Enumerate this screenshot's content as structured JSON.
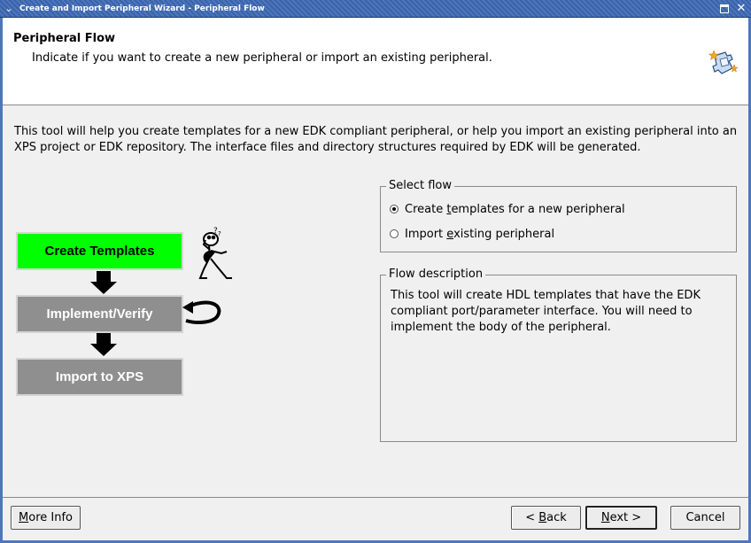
{
  "window": {
    "title": "Create and Import Peripheral Wizard - Peripheral Flow"
  },
  "header": {
    "title": "Peripheral Flow",
    "subtitle": "Indicate if you want to create a new peripheral or import an existing peripheral."
  },
  "intro": "This tool will help you create templates for a new EDK compliant peripheral, or help you import an existing peripheral into an XPS project or EDK repository. The interface files and directory structures required by EDK will be generated.",
  "diagram": {
    "steps": [
      "Create Templates",
      "Implement/Verify",
      "Import to XPS"
    ],
    "active_step_color": "#00ff00",
    "inactive_step_color": "#8f8f8f"
  },
  "select_flow": {
    "legend": "Select flow",
    "options": [
      {
        "pre": "Create ",
        "mnemonic": "t",
        "post": "emplates for a new peripheral",
        "checked": true
      },
      {
        "pre": "Import ",
        "mnemonic": "e",
        "post": "xisting peripheral",
        "checked": false
      }
    ]
  },
  "flow_description": {
    "legend": "Flow description",
    "text": "This tool will create HDL templates that have the EDK compliant port/parameter interface. You will need to implement the body of the peripheral."
  },
  "buttons": {
    "more_info": {
      "mnemonic": "M",
      "rest": "ore Info"
    },
    "back": {
      "pre": "< ",
      "mnemonic": "B",
      "rest": "ack"
    },
    "next": {
      "mnemonic": "N",
      "rest": "ext >"
    },
    "cancel": "Cancel"
  }
}
